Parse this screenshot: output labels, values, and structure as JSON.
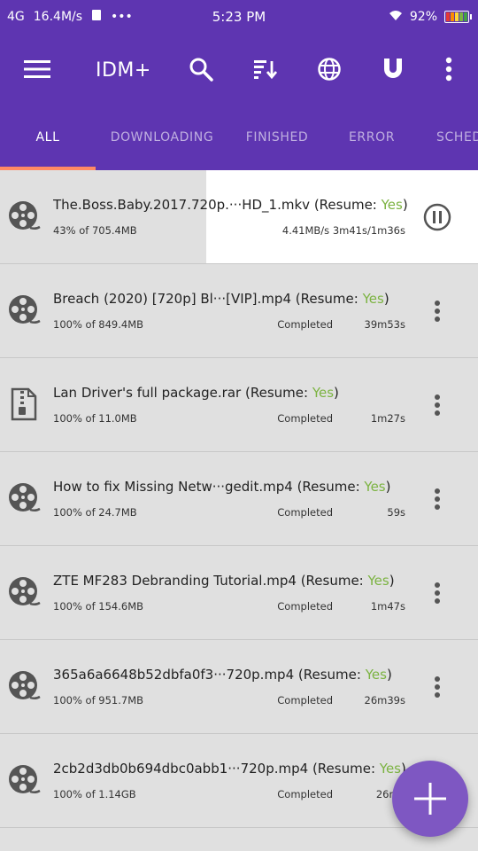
{
  "status_bar": {
    "network": "4G",
    "speed": "16.4M/s",
    "dots": "•••",
    "time": "5:23 PM",
    "battery": "92%"
  },
  "app_bar": {
    "title": "IDM+",
    "icons": [
      "menu-icon",
      "search-icon",
      "sort-icon",
      "browser-icon",
      "magnet-icon",
      "more-vert-icon"
    ]
  },
  "tabs": [
    {
      "label": "ALL",
      "active": true
    },
    {
      "label": "DOWNLOADING",
      "active": false
    },
    {
      "label": "FINISHED",
      "active": false
    },
    {
      "label": "ERROR",
      "active": false
    },
    {
      "label": "SCHED",
      "active": false
    }
  ],
  "colors": {
    "primary": "#5e35b1",
    "accent_indicator": "#ff8a65",
    "yes_green": "#7cb342",
    "fab": "#7e57c2"
  },
  "downloads": [
    {
      "name": "The.Boss.Baby.2017.720p.···HD_1.mkv",
      "resume_label": "(Resume: ",
      "resume_value": "Yes",
      "resume_end": ")",
      "size": "43% of 705.4MB",
      "rate": "4.41MB/s  3m41s/1m36s",
      "icon": "film-reel-icon",
      "state": "downloading",
      "progress": 0.43
    },
    {
      "name": "Breach (2020) [720p] Bl···[VIP].mp4",
      "resume_label": "(Resume: ",
      "resume_value": "Yes",
      "resume_end": ")",
      "size": "100% of 849.4MB",
      "status": "Completed",
      "time": "39m53s",
      "icon": "film-reel-icon",
      "state": "completed"
    },
    {
      "name": "Lan Driver's full package.rar",
      "resume_label": "(Resume: ",
      "resume_value": "Yes",
      "resume_end": ")",
      "size": "100% of 11.0MB",
      "status": "Completed",
      "time": "1m27s",
      "icon": "archive-icon",
      "state": "completed"
    },
    {
      "name": "How to fix Missing Netw···gedit.mp4",
      "resume_label": "(Resume: ",
      "resume_value": "Yes",
      "resume_end": ")",
      "size": "100% of 24.7MB",
      "status": "Completed",
      "time": "59s",
      "icon": "film-reel-icon",
      "state": "completed"
    },
    {
      "name": "ZTE MF283 Debranding Tutorial.mp4",
      "resume_label": "(Resume: ",
      "resume_value": "Yes",
      "resume_end": ")",
      "size": "100% of 154.6MB",
      "status": "Completed",
      "time": "1m47s",
      "icon": "film-reel-icon",
      "state": "completed"
    },
    {
      "name": "365a6a6648b52dbfa0f3···720p.mp4",
      "resume_label": "(Resume: ",
      "resume_value": "Yes",
      "resume_end": ")",
      "size": "100% of 951.7MB",
      "status": "Completed",
      "time": "26m39s",
      "icon": "film-reel-icon",
      "state": "completed"
    },
    {
      "name": "2cb2d3db0b694dbc0abb1···720p.mp4",
      "resume_label": "(Resume: ",
      "resume_value": "Yes",
      "resume_end": ")",
      "size": "100% of 1.14GB",
      "status": "Completed",
      "time": "26m3",
      "icon": "film-reel-icon",
      "state": "completed"
    }
  ],
  "fab": {
    "icon": "plus-icon"
  }
}
